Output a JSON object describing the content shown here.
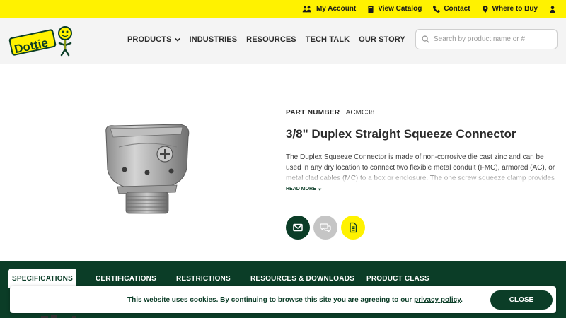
{
  "topbar": {
    "items": [
      {
        "label": "My Account",
        "icon": "users-icon"
      },
      {
        "label": "View Catalog",
        "icon": "book-icon"
      },
      {
        "label": "Contact",
        "icon": "phone-icon"
      },
      {
        "label": "Where to Buy",
        "icon": "map-marker-icon"
      },
      {
        "label": "",
        "icon": "user-icon"
      }
    ],
    "color": "#fff200"
  },
  "header": {
    "logo_text": "Dottie",
    "nav": [
      {
        "label": "PRODUCTS",
        "has_dropdown": true
      },
      {
        "label": "INDUSTRIES"
      },
      {
        "label": "RESOURCES"
      },
      {
        "label": "TECH TALK"
      },
      {
        "label": "OUR STORY"
      }
    ],
    "search_placeholder": "Search by product name or #"
  },
  "product": {
    "part_number_label": "PART NUMBER",
    "part_number": "ACMC38",
    "title": "3/8\" Duplex Straight Squeeze Connector",
    "description": "The Duplex Squeeze Connector is made of non-corrosive die cast zinc and can be used in any dry location to connect two flexible metal conduit (FMC), armored (AC), or metal clad cables (MC) to a box or enclosure. The one screw squeeze clamp provides a",
    "read_more": "READ MORE",
    "actions": [
      {
        "icon": "envelope-icon",
        "color": "#0b3d27"
      },
      {
        "icon": "chat-icon",
        "color": "#c5c5c5"
      },
      {
        "icon": "document-icon",
        "color": "#fff200"
      }
    ]
  },
  "tabs": {
    "items": [
      "SPECIFICATIONS",
      "CERTIFICATIONS",
      "RESTRICTIONS",
      "RESOURCES & DOWNLOADS",
      "PRODUCT CLASS"
    ],
    "active": "SPECIFICATIONS",
    "band_color": "#0b3d27"
  },
  "cookie": {
    "text_before": "This website uses cookies. By continuing to browse this site you are agreeing to our ",
    "link": "privacy policy",
    "text_after": ".",
    "close_label": "CLOSE"
  }
}
